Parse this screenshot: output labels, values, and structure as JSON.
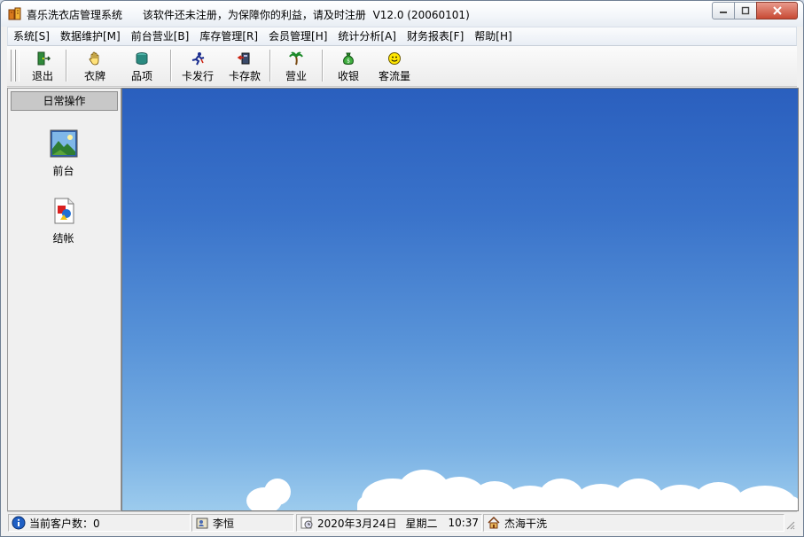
{
  "window": {
    "title": "喜乐洗衣店管理系统",
    "notice": "该软件还未注册，为保障你的利益，请及时注册",
    "version": "V12.0 (20060101)"
  },
  "menu": [
    {
      "label": "系统[S]"
    },
    {
      "label": "数据维护[M]"
    },
    {
      "label": "前台营业[B]"
    },
    {
      "label": "库存管理[R]"
    },
    {
      "label": "会员管理[H]"
    },
    {
      "label": "统计分析[A]"
    },
    {
      "label": "财务报表[F]"
    },
    {
      "label": "帮助[H]"
    }
  ],
  "toolbar": {
    "exit": "退出",
    "tag": "衣牌",
    "item": "品项",
    "card_issue": "卡发行",
    "card_deposit": "卡存款",
    "business": "营业",
    "cashier": "收银",
    "traffic": "客流量"
  },
  "sidebar": {
    "header": "日常操作",
    "items": [
      {
        "label": "前台"
      },
      {
        "label": "结帐"
      }
    ]
  },
  "status": {
    "customers": "当前客户数：0",
    "user": "李恒",
    "date": "2020年3月24日",
    "weekday": "星期二",
    "time": "10:37",
    "store": "杰海干洗"
  },
  "colors": {
    "sky_top": "#2a5fbe",
    "sky_bottom": "#9ccbed",
    "close_button": "#c74a34"
  }
}
